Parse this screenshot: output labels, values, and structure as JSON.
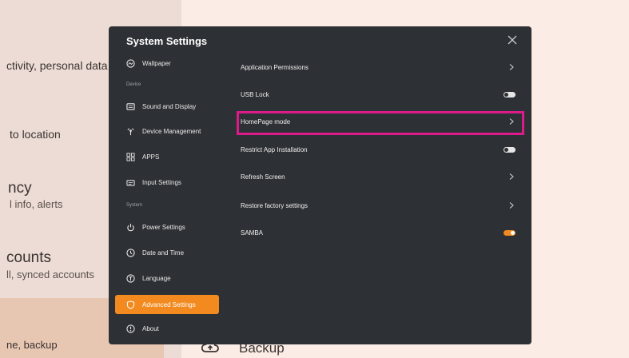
{
  "background": {
    "texts": [
      "ctivity, personal data",
      "to location",
      "ncy",
      "l info, alerts",
      "counts",
      "ll, synced accounts",
      "ne, backup"
    ],
    "backup_label": "Backup",
    "selected_color": "#e7c6b2"
  },
  "dialog": {
    "title": "System Settings",
    "close_icon": "close-icon",
    "sidebar": {
      "items": [
        {
          "label": "Wallpaper",
          "icon": "wallpaper-icon"
        },
        {
          "label": "Sound and Display",
          "icon": "display-icon"
        },
        {
          "label": "Device Management",
          "icon": "device-icon"
        },
        {
          "label": "APPS",
          "icon": "apps-icon"
        },
        {
          "label": "Input Settings",
          "icon": "input-icon"
        },
        {
          "label": "Power Settings",
          "icon": "power-icon"
        },
        {
          "label": "Date and Time",
          "icon": "clock-icon"
        },
        {
          "label": "Language",
          "icon": "language-icon"
        },
        {
          "label": "Advanced Settings",
          "icon": "shield-icon",
          "active": true
        },
        {
          "label": "About",
          "icon": "info-icon"
        }
      ],
      "sections": [
        "Device",
        "System"
      ]
    },
    "content": {
      "rows": [
        {
          "label": "Application Permissions",
          "control": "chevron"
        },
        {
          "label": "USB Lock",
          "control": "toggle",
          "on": false
        },
        {
          "label": "HomePage mode",
          "control": "chevron"
        },
        {
          "label": "Restrict App Installation",
          "control": "toggle",
          "on": false
        },
        {
          "label": "Refresh Screen",
          "control": "chevron"
        },
        {
          "label": "Restore factory settings",
          "control": "chevron"
        },
        {
          "label": "SAMBA",
          "control": "toggle",
          "on": true
        }
      ]
    },
    "colors": {
      "accent": "#f28a1f",
      "background": "#2d3034",
      "highlight": "#dd1a8a"
    }
  }
}
